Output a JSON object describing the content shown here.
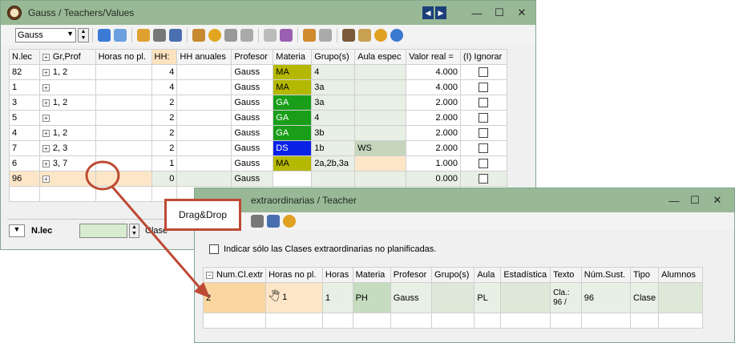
{
  "main_window": {
    "title": "Gauss / Teachers/Values",
    "selector_value": "Gauss",
    "columns": [
      "N.lec",
      "Gr,Prof",
      "Horas no pl.",
      "HH:",
      "HH anuales",
      "Profesor",
      "Materia",
      "Grupo(s)",
      "Aula espec",
      "Valor real =",
      "(I) Ignorar"
    ],
    "rows": [
      {
        "nlec": "82",
        "gr": "1, 2",
        "horas": "",
        "hh": "4",
        "hha": "",
        "prof": "Gauss",
        "mat": "MA",
        "grupo": "4",
        "aula": "",
        "valor": "4.000"
      },
      {
        "nlec": "1",
        "gr": "",
        "horas": "",
        "hh": "4",
        "hha": "",
        "prof": "Gauss",
        "mat": "MA",
        "grupo": "3a",
        "aula": "",
        "valor": "4.000"
      },
      {
        "nlec": "3",
        "gr": "1, 2",
        "horas": "",
        "hh": "2",
        "hha": "",
        "prof": "Gauss",
        "mat": "GA",
        "grupo": "3a",
        "aula": "",
        "valor": "2.000"
      },
      {
        "nlec": "5",
        "gr": "",
        "horas": "",
        "hh": "2",
        "hha": "",
        "prof": "Gauss",
        "mat": "GA",
        "grupo": "4",
        "aula": "",
        "valor": "2.000"
      },
      {
        "nlec": "4",
        "gr": "1, 2",
        "horas": "",
        "hh": "2",
        "hha": "",
        "prof": "Gauss",
        "mat": "GA",
        "grupo": "3b",
        "aula": "",
        "valor": "2.000"
      },
      {
        "nlec": "7",
        "gr": "2, 3",
        "horas": "",
        "hh": "2",
        "hha": "",
        "prof": "Gauss",
        "mat": "DS",
        "grupo": "1b",
        "aula": "WS",
        "valor": "2.000"
      },
      {
        "nlec": "6",
        "gr": "3, 7",
        "horas": "",
        "hh": "1",
        "hha": "",
        "prof": "Gauss",
        "mat": "MA",
        "grupo": "2a,2b,3a",
        "aula": "",
        "valor": "1.000"
      },
      {
        "nlec": "96",
        "gr": "",
        "horas": "",
        "hh": "0",
        "hha": "",
        "prof": "Gauss",
        "mat": "",
        "grupo": "",
        "aula": "",
        "valor": "0.000"
      }
    ],
    "footer_label": "N.lec",
    "footer_partial": "Clase"
  },
  "sub_window": {
    "title": "extraordinarias / Teacher",
    "checkbox_label": "Indicar sólo las Clases extraordinarias no planificadas.",
    "columns": [
      "Num.Cl.extr",
      "Horas no pl.",
      "Horas",
      "Materia",
      "Profesor",
      "Grupo(s)",
      "Aula",
      "Estadística",
      "Texto",
      "Núm.Sust.",
      "Tipo",
      "Alumnos"
    ],
    "row": {
      "num": "2",
      "horas_no": "1",
      "horas": "1",
      "materia": "PH",
      "profesor": "Gauss",
      "grupo": "",
      "aula": "PL",
      "estad": "",
      "texto1": "Cla.:",
      "texto2": "96 /",
      "sust": "96",
      "tipo": "Clase",
      "alumnos": ""
    }
  },
  "callout": "Drag&Drop",
  "colors": {
    "MA": "#b5b800",
    "GA": "#1a9e1a",
    "DS": "#0a22e6",
    "titlebar": "#99b896",
    "arrow": "#bd4a34"
  }
}
